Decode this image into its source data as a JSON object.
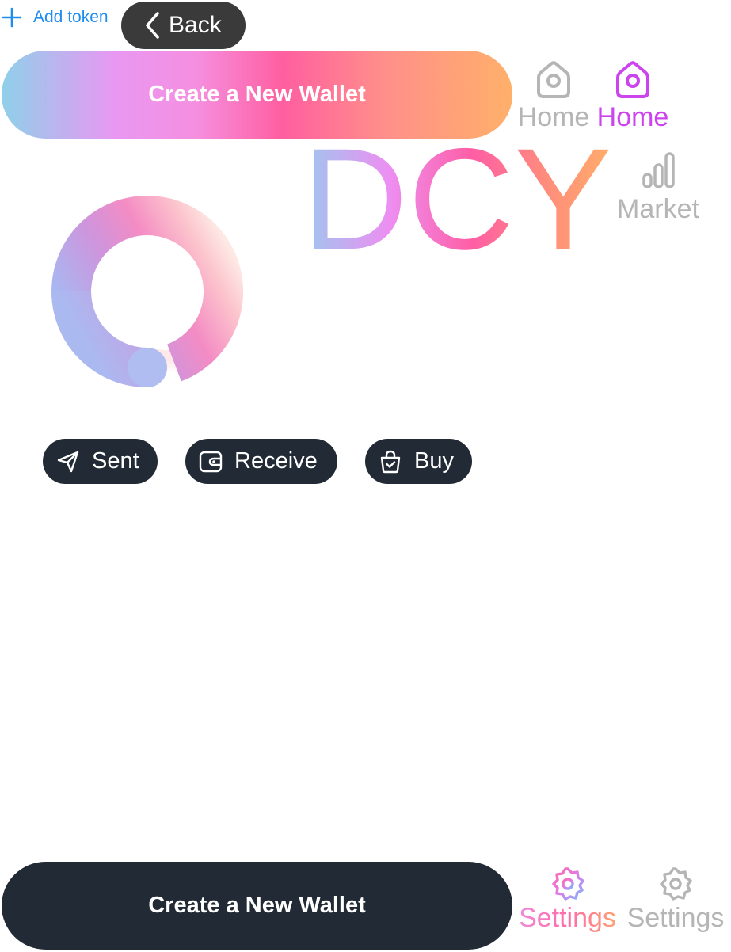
{
  "header": {
    "add_token_label": "Add token",
    "add_token_icon": "plus-icon",
    "back_label": "Back",
    "back_icon": "chevron-left-icon"
  },
  "buttons": {
    "create_wallet_top": "Create a New Wallet",
    "create_wallet_bottom": "Create a New Wallet"
  },
  "nav": {
    "home_inactive": {
      "label": "Home",
      "icon": "home-icon"
    },
    "home_active": {
      "label": "Home",
      "icon": "home-icon"
    },
    "market": {
      "label": "Market",
      "icon": "bar-chart-icon"
    },
    "settings_active": {
      "label": "Settings",
      "icon": "gear-icon"
    },
    "settings_inactive": {
      "label": "Settings",
      "icon": "gear-icon"
    }
  },
  "logo": {
    "text": "DCY"
  },
  "actions": [
    {
      "label": "Sent",
      "icon": "send-icon"
    },
    {
      "label": "Receive",
      "icon": "wallet-icon"
    },
    {
      "label": "Buy",
      "icon": "shopping-bag-icon"
    }
  ],
  "colors": {
    "link_blue": "#1f8cf0",
    "dark_pill": "#222a35",
    "back_pill": "#3a3a3a",
    "inactive_gray": "#b5b5b5",
    "active_purple": "#cc44ee"
  }
}
